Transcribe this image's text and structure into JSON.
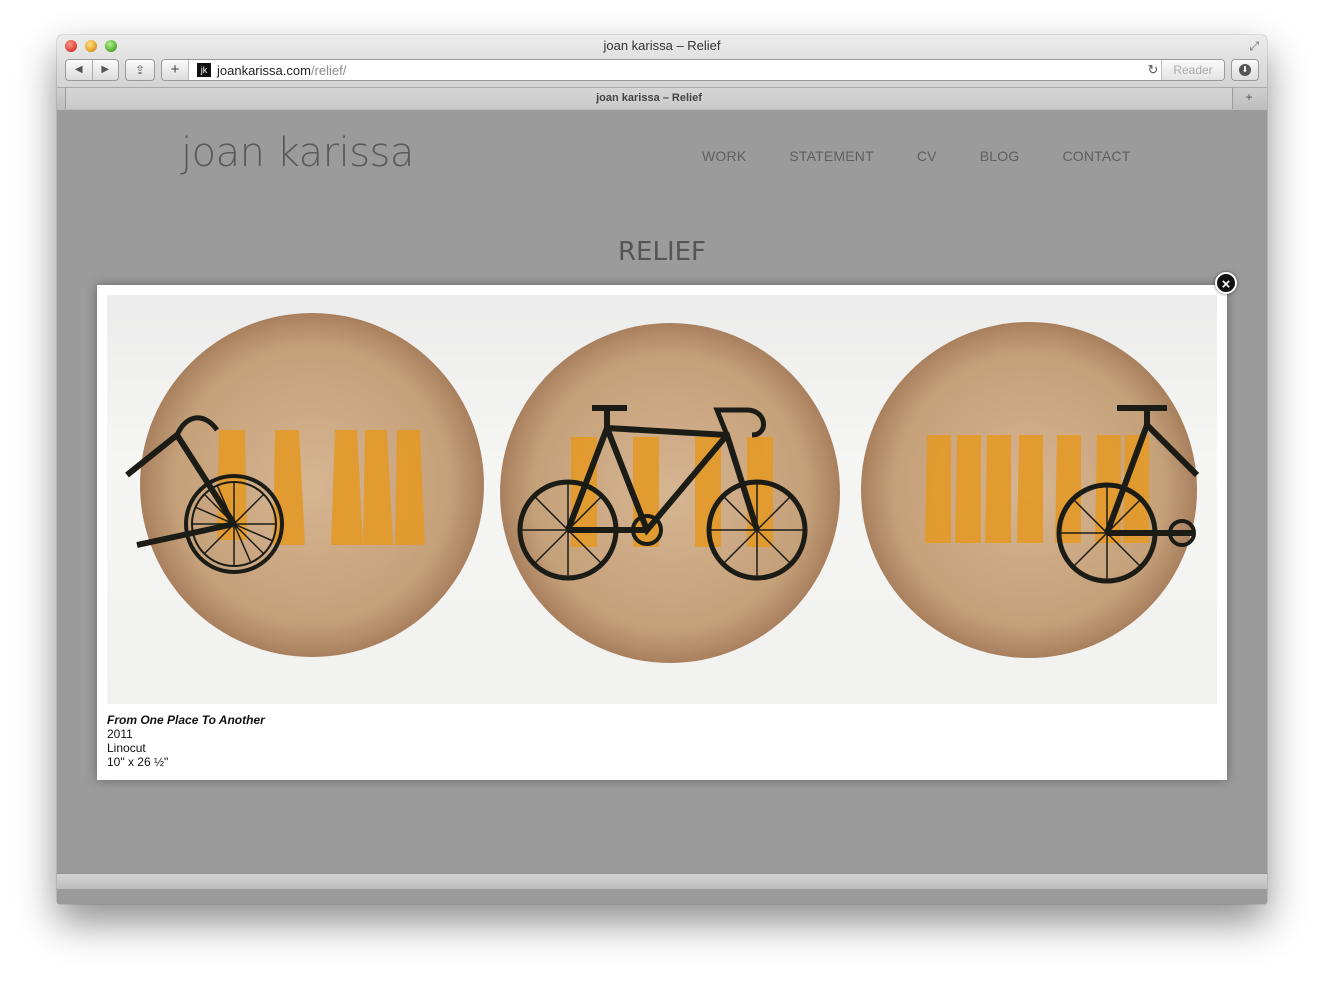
{
  "browser": {
    "window_title": "joan karissa – Relief",
    "tab_title": "joan karissa – Relief",
    "url_domain": "joankarissa.com",
    "url_path": "/relief/",
    "favicon_text": "jk",
    "reader_label": "Reader",
    "add_label": "+",
    "reload_glyph": "↻",
    "back_glyph": "◀",
    "forward_glyph": "▶",
    "share_glyph": "⇪",
    "new_tab_glyph": "+",
    "fullscreen_glyph": "⤢",
    "download_glyph": "⬇"
  },
  "site": {
    "logo": "joan karissa",
    "nav": [
      "WORK",
      "STATEMENT",
      "CV",
      "BLOG",
      "CONTACT"
    ],
    "heading": "RELIEF"
  },
  "lightbox": {
    "close_glyph": "×",
    "caption": {
      "title": "From One Place To Another",
      "year": "2011",
      "medium": "Linocut",
      "size": "10\" x 26 ½\""
    },
    "artwork_icon": "bicycle-linocut-triptych",
    "colors": {
      "disc": "#c9a580",
      "stripes": "#e39a2a",
      "ink": "#1c1c16"
    }
  }
}
